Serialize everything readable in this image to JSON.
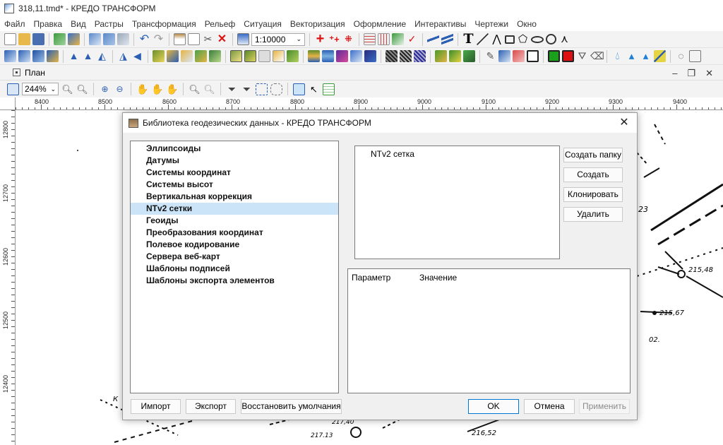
{
  "window": {
    "title": "318,11.tmd* - КРЕДО ТРАНСФОРМ"
  },
  "menu": [
    "Файл",
    "Правка",
    "Вид",
    "Растры",
    "Трансформация",
    "Рельеф",
    "Ситуация",
    "Векторизация",
    "Оформление",
    "Интерактивы",
    "Чертежи",
    "Окно"
  ],
  "toolbar": {
    "scale_value": "1:10000"
  },
  "document": {
    "title": "План"
  },
  "viewbar": {
    "zoom_value": "244%"
  },
  "ruler": {
    "top_labels": [
      "8400",
      "8500",
      "8600",
      "8700",
      "8800",
      "8900",
      "9000",
      "9100",
      "9200",
      "9300",
      "9400"
    ],
    "left_labels": [
      "12800",
      "12700",
      "12600",
      "12500",
      "12400"
    ]
  },
  "map_labels": {
    "label_23": "23",
    "label_21548": "215,48",
    "label_21567": "215,67",
    "label_02": "02.",
    "label_21713": "217.13",
    "label_21652": "216,52",
    "label_21740": "217,40",
    "label_k": "К"
  },
  "dialog": {
    "title": "Библиотека геодезических данных - КРЕДО ТРАНСФОРМ",
    "categories": [
      "Эллипсоиды",
      "Датумы",
      "Системы координат",
      "Системы высот",
      "Вертикальная коррекция",
      "NTv2 сетки",
      "Геоиды",
      "Преобразования координат",
      "Полевое кодирование",
      "Сервера веб-карт",
      "Шаблоны подписей",
      "Шаблоны экспорта элементов"
    ],
    "selected_category": "NTv2 сетки",
    "items": [
      "NTv2 сетка"
    ],
    "side_buttons": {
      "create_folder": "Создать папку",
      "create": "Создать",
      "clone": "Клонировать",
      "delete": "Удалить"
    },
    "param_table": {
      "col_param": "Параметр",
      "col_value": "Значение"
    },
    "bottom": {
      "import": "Импорт",
      "export": "Экспорт",
      "restore": "Восстановить умолчания",
      "ok": "OK",
      "cancel": "Отмена",
      "apply": "Применить"
    }
  }
}
